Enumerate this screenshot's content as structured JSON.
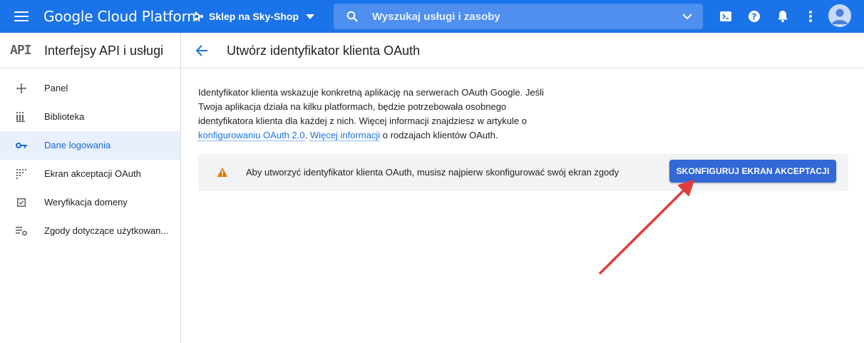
{
  "topbar": {
    "brand": "Google Cloud Platform",
    "project_name": "Sklep na Sky-Shop",
    "search_placeholder": "Wyszukaj usługi i zasoby",
    "colors": {
      "bar": "#1a73e8",
      "search_bg": "#4e8ff0"
    },
    "icons": [
      "menu-icon",
      "project-icon",
      "search-icon",
      "cloud-shell-icon",
      "help-icon",
      "notifications-icon",
      "more-vert-icon",
      "account-avatar"
    ]
  },
  "sidebar": {
    "logo": "API",
    "title": "Interfejsy API i usługi",
    "items": [
      {
        "label": "Panel",
        "icon": "dashboard-icon",
        "active": false
      },
      {
        "label": "Biblioteka",
        "icon": "library-icon",
        "active": false
      },
      {
        "label": "Dane logowania",
        "icon": "key-icon",
        "active": true
      },
      {
        "label": "Ekran akceptacji OAuth",
        "icon": "consent-screen-icon",
        "active": false
      },
      {
        "label": "Weryfikacja domeny",
        "icon": "domain-check-icon",
        "active": false
      },
      {
        "label": "Zgody dotyczące użytkowan...",
        "icon": "settings-list-icon",
        "active": false
      }
    ]
  },
  "main": {
    "title": "Utwórz identyfikator klienta OAuth",
    "description": {
      "line1": "Identyfikator klienta wskazuje konkretną aplikację na serwerach OAuth Google. Jeśli",
      "line2": "Twoja aplikacja działa na kilku platformach, będzie potrzebowała osobnego",
      "line3": "identyfikatora klienta dla każdej z nich. Więcej informacji znajdziesz w artykule o",
      "link1": "konfigurowaniu OAuth 2.0",
      "sep": ".",
      "link2": "Więcej informacji",
      "tail": "o rodzajach klientów OAuth."
    },
    "notice": {
      "message": "Aby utworzyć identyfikator klienta OAuth, musisz najpierw skonfigurować swój ekran zgody",
      "button": "SKONFIGURUJ EKRAN AKCEPTACJI",
      "warning_color": "#e37400",
      "button_color": "#3367d6"
    },
    "annotation_arrow_color": "#e03c3c"
  }
}
